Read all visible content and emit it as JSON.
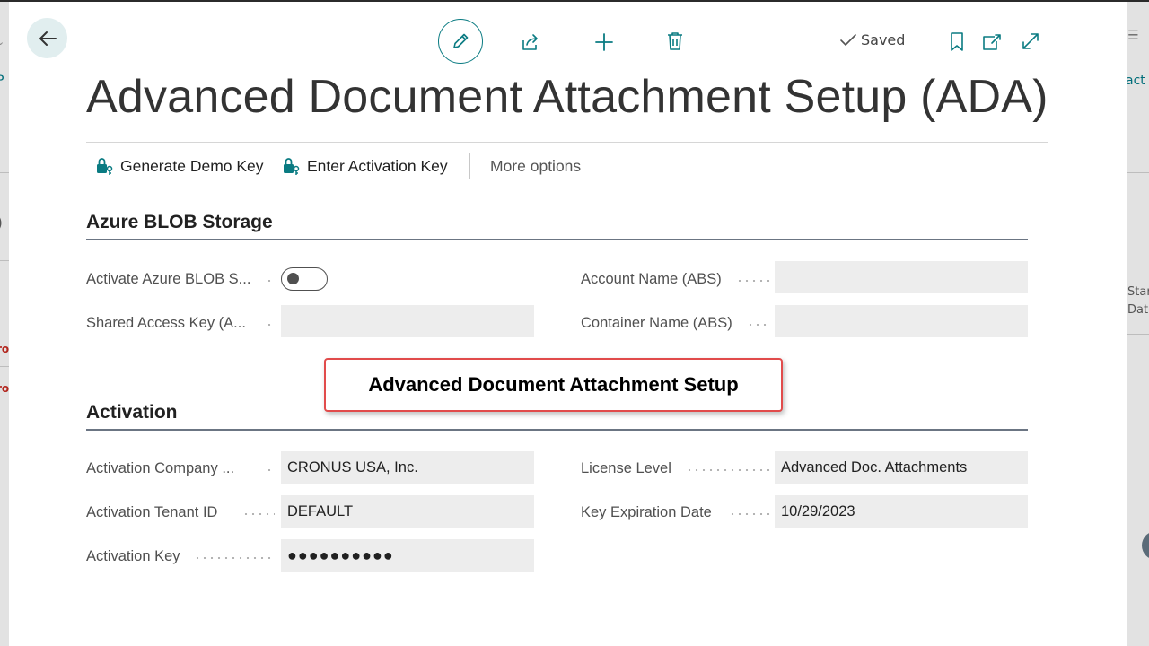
{
  "page": {
    "title": "Advanced Document Attachment Setup (ADA)",
    "saved_label": "Saved"
  },
  "actions": {
    "generate_demo_key": "Generate Demo Key",
    "enter_activation_key": "Enter Activation Key",
    "more_options": "More options"
  },
  "azure_blob": {
    "title": "Azure BLOB Storage",
    "activate_label": "Activate Azure BLOB S...",
    "activate_value": false,
    "shared_access_key_label": "Shared Access Key (A...",
    "shared_access_key_value": "",
    "account_name_label": "Account Name (ABS)",
    "account_name_value": "",
    "container_name_label": "Container Name (ABS)",
    "container_name_value": ""
  },
  "activation": {
    "title": "Activation",
    "company_label": "Activation Company ...",
    "company_value": "CRONUS USA, Inc.",
    "tenant_label": "Activation Tenant ID",
    "tenant_value": "DEFAULT",
    "key_label": "Activation Key",
    "key_value": "●●●●●●●●●●",
    "license_label": "License Level",
    "license_value": "Advanced Doc. Attachments",
    "expiration_label": "Key Expiration Date",
    "expiration_value": "10/29/2023"
  },
  "callout": {
    "text": "Advanced Document Attachment Setup"
  },
  "background": {
    "left_fragment_1": "P",
    "left_fragment_2": ")",
    "left_fragment_3": "ro",
    "left_fragment_4": "ro",
    "right_fragment_1": "act",
    "right_fragment_2": "Star",
    "right_fragment_3": "Date"
  },
  "colors": {
    "accent": "#0a7b82",
    "callout_border": "#e14b4b",
    "field_background": "#ededed",
    "section_rule": "#6b7583"
  }
}
